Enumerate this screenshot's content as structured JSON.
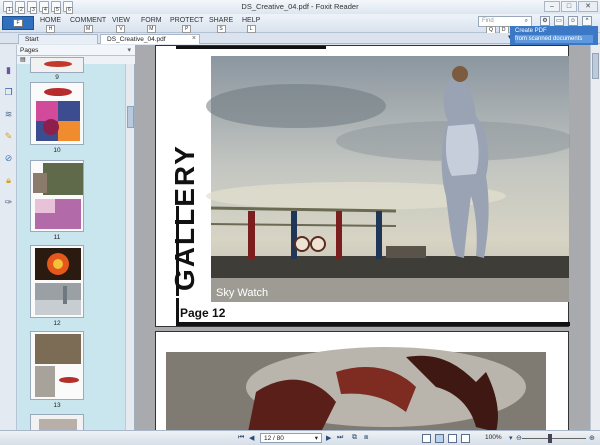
{
  "window": {
    "title": "DS_Creative_04.pdf - Foxit Reader"
  },
  "quick_access": {
    "keys": [
      "1",
      "2",
      "3",
      "4",
      "5",
      "6"
    ]
  },
  "ribbon": {
    "file": {
      "label": "F"
    },
    "tabs": [
      {
        "label": "HOME",
        "key": "H"
      },
      {
        "label": "COMMENT",
        "key": "M"
      },
      {
        "label": "VIEW",
        "key": "V"
      },
      {
        "label": "FORM",
        "key": "M"
      },
      {
        "label": "PROTECT",
        "key": "P"
      },
      {
        "label": "SHARE",
        "key": "S"
      },
      {
        "label": "HELP",
        "key": "L"
      }
    ],
    "find_placeholder": "Find",
    "find_keys": [
      "Q",
      "D"
    ],
    "right_keys": [
      "F",
      "N",
      "G",
      "O"
    ]
  },
  "doc_tabs": [
    {
      "label": "Start"
    },
    {
      "label": "DS_Creative_04.pdf"
    }
  ],
  "tooltip": {
    "line1": "Create PDF",
    "line2": "from scanned documents"
  },
  "pages_panel": {
    "title": "Pages",
    "thumbnails": [
      {
        "label": "9"
      },
      {
        "label": "10"
      },
      {
        "label": "11"
      },
      {
        "label": "12"
      },
      {
        "label": "13"
      },
      {
        "label": ""
      }
    ]
  },
  "document": {
    "page": {
      "heading": "GALLERY",
      "page_label": "Page 12",
      "caption": "Sky Watch"
    }
  },
  "status": {
    "page_field": "12 / 80",
    "zoom": "100%"
  },
  "colors": {
    "accent": "#2f6fbf",
    "panel_bg": "#c9e6ee",
    "selected_thumb": "#d03030",
    "doc_bg": "#a8aaad"
  }
}
